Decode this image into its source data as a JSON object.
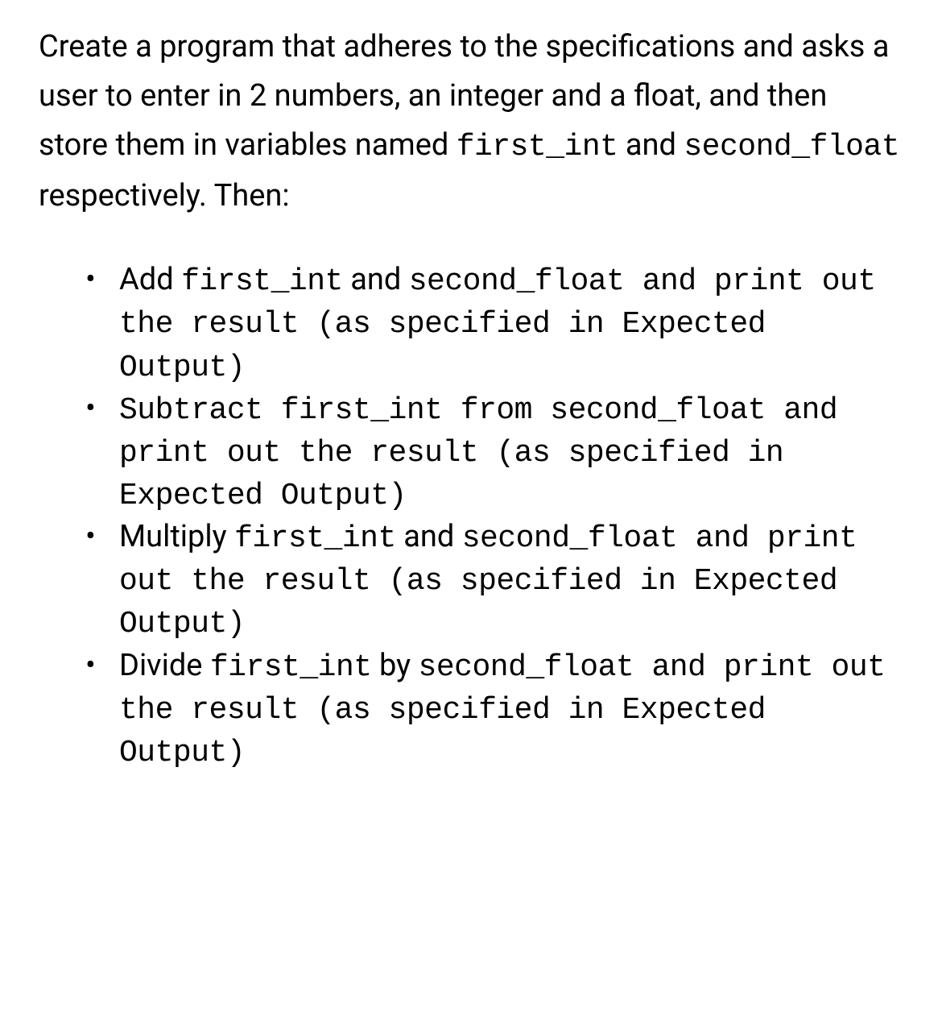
{
  "intro": {
    "beforeCode1": "Create a program that adheres to the specifications and asks a user to enter in 2 numbers, an integer and a float, and then store them in variables named ",
    "code1": "first_int",
    "middle": " and ",
    "code2": "second_float",
    "afterCode2": " respectively. Then:"
  },
  "items": [
    {
      "prefix": "Add ",
      "var1": "first_int",
      "middle": " and ",
      "var2": "second_float",
      "tail": " and print out the result (as specified in Expected Output)"
    },
    {
      "tail": "Subtract first_int from second_float and print out the result (as specified in Expected Output)"
    },
    {
      "prefix": "Multiply ",
      "var1": "first_int",
      "middle": " and ",
      "var2": "second_float",
      "tail": " and print out the result (as specified in Expected Output)"
    },
    {
      "prefix": "Divide ",
      "var1": "first_int",
      "middle": " by ",
      "var2": "second_float",
      "tail": " and print out the result (as specified in Expected Output)"
    }
  ]
}
